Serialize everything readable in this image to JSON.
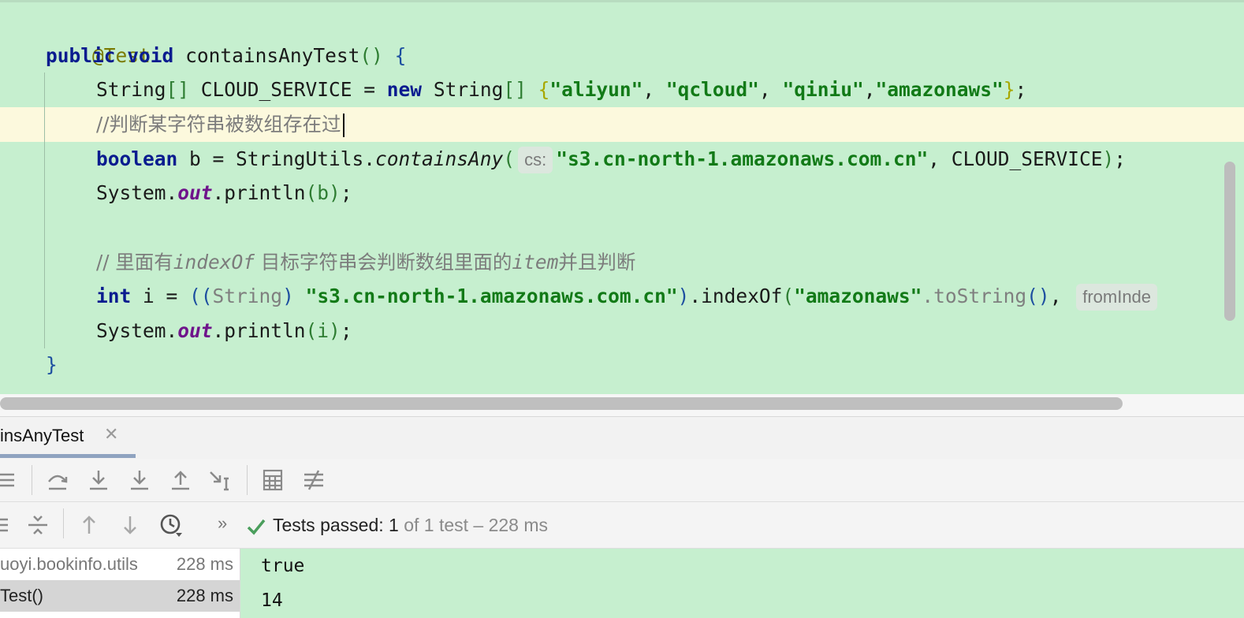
{
  "editor": {
    "lines": {
      "annotation": "@Test",
      "method_kw_public": "public",
      "method_kw_void": "void",
      "method_name": "containsAnyTest",
      "method_parens": "()",
      "open_brace": "{",
      "l3_type": "String",
      "l3_arr": "[]",
      "l3_var": " CLOUD_SERVICE = ",
      "l3_new": "new",
      "l3_type2": " String",
      "l3_arr2": "[]",
      "l3_obrace": "{",
      "l3_s1": "\"aliyun\"",
      "l3_c1": ", ",
      "l3_s2": "\"qcloud\"",
      "l3_c2": ", ",
      "l3_s3": "\"qiniu\"",
      "l3_c3": ",",
      "l3_s4": "\"amazonaws\"",
      "l3_cbrace": "}",
      "l3_end": ";",
      "l4_comment": "//判断某字符串被数组存在过",
      "l5_kw": "boolean",
      "l5_pre": " b = StringUtils.",
      "l5_method": "containsAny",
      "l5_paren": "(",
      "l5_hint": "cs:",
      "l5_str": "\"s3.cn-north-1.amazonaws.com.cn\"",
      "l5_post": ", CLOUD_SERVICE",
      "l5_cparen": ")",
      "l5_end": ";",
      "l6_pre": "System.",
      "l6_out": "out",
      "l6_post": ".println",
      "l6_arg": "(b)",
      "l6_end": ";",
      "l8_c1": "// 里面有",
      "l8_c2": "indexOf",
      "l8_c3": " 目标字符串会判断数组里面的",
      "l8_c4": "item",
      "l8_c5": "并且判断",
      "l9_kw": "int",
      "l9_pre": " i = ",
      "l9_p1": "((",
      "l9_cast": "String",
      "l9_p2": ")",
      "l9_str": " \"s3.cn-north-1.amazonaws.com.cn\"",
      "l9_p3": ")",
      "l9_idx": ".indexOf",
      "l9_p4": "(",
      "l9_str2": "\"amazonaws\"",
      "l9_tostr": ".toString",
      "l9_p5": "()",
      "l9_comma": ", ",
      "l9_hint": "fromInde",
      "l10_pre": "System.",
      "l10_out": "out",
      "l10_post": ".println",
      "l10_arg": "(i)",
      "l10_end": ";",
      "close_brace": "}"
    }
  },
  "run_tab": {
    "label": "insAnyTest",
    "close": "✕"
  },
  "status": {
    "passed_label": "Tests passed: 1",
    "rest": " of 1 test – 228 ms",
    "more": "»"
  },
  "test_tree": {
    "rows": [
      {
        "name": "uoyi.bookinfo.utils",
        "time": "228 ms"
      },
      {
        "name": "Test()",
        "time": "228 ms"
      }
    ]
  },
  "console": {
    "lines": [
      "true",
      "14"
    ]
  },
  "icons": {
    "pass_color": "#4a9e5c",
    "tool_color": "#8a8a8a"
  }
}
